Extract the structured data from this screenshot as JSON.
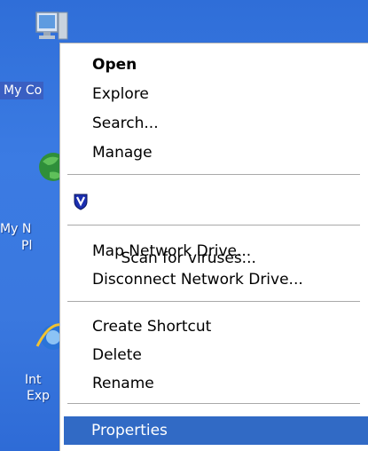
{
  "desktop": {
    "icons": [
      {
        "name": "my-computer",
        "label_lines": [
          "My Co"
        ]
      },
      {
        "name": "my-network-places",
        "label_lines": [
          "My N",
          "Pl"
        ]
      },
      {
        "name": "internet-explorer",
        "label_lines": [
          "Int",
          "Exp"
        ]
      }
    ]
  },
  "context_menu": {
    "items": [
      {
        "label": "Open",
        "bold": true
      },
      {
        "label": "Explore"
      },
      {
        "label": "Search..."
      },
      {
        "label": "Manage"
      },
      {
        "label": "Scan for viruses...",
        "icon": "shield-icon"
      },
      {
        "label": "Map Network Drive..."
      },
      {
        "label": "Disconnect Network Drive..."
      },
      {
        "label": "Create Shortcut"
      },
      {
        "label": "Delete"
      },
      {
        "label": "Rename"
      },
      {
        "label": "Properties",
        "highlighted": true
      }
    ]
  },
  "colors": {
    "desktop_blue": "#3a78df",
    "menu_highlight": "#316ac5",
    "selected_label": "#3a5fc2"
  }
}
